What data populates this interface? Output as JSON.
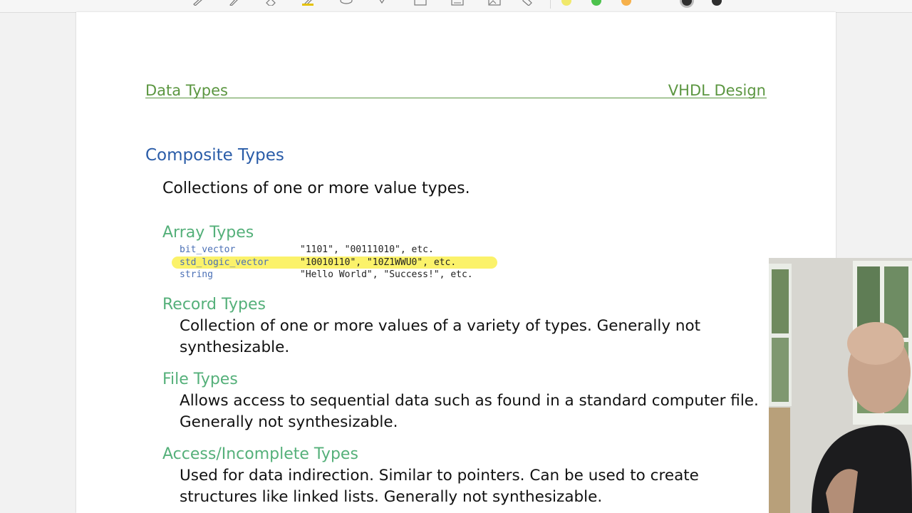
{
  "header": {
    "left": "Data Types",
    "right": "VHDL Design"
  },
  "toolbar": {
    "icons": [
      "pen-icon",
      "eraser-icon",
      "highlighter-icon",
      "lasso-icon",
      "hand-icon",
      "shape-icon",
      "text-icon",
      "image-icon",
      "tag-icon"
    ],
    "colors": [
      "#f1e96c",
      "#4dc24d",
      "#f6b04a",
      "#bdbdbd",
      "#2f2f2f",
      "#2f2f2f"
    ]
  },
  "slide": {
    "title": "Composite Types",
    "intro": "Collections of one or more value types.",
    "array_types": {
      "heading": "Array Types",
      "rows": [
        {
          "type": "bit_vector",
          "example": "\"1101\", \"00111010\", etc."
        },
        {
          "type": "std_logic_vector",
          "example": "\"10010110\", \"10Z1WWU0\", etc.",
          "highlighted": true
        },
        {
          "type": "string",
          "example": "\"Hello World\", \"Success!\", etc."
        }
      ]
    },
    "record_types": {
      "heading": "Record Types",
      "text": "Collection of one or more values of a variety of types. Generally not synthesizable."
    },
    "file_types": {
      "heading": "File Types",
      "text": "Allows access to sequential data such as found in a standard computer file. Generally not synthesizable."
    },
    "access_types": {
      "heading": "Access/Incomplete Types",
      "text": "Used for data indirection.  Similar to pointers.  Can be used to create structures like linked lists. Generally not synthesizable."
    }
  },
  "colors": {
    "header_green": "#5b9640",
    "title_blue": "#2a5ca8",
    "subheading_green": "#55b07a",
    "code_type_blue": "#4a6fb5",
    "highlight_yellow": "#fbf26a"
  }
}
